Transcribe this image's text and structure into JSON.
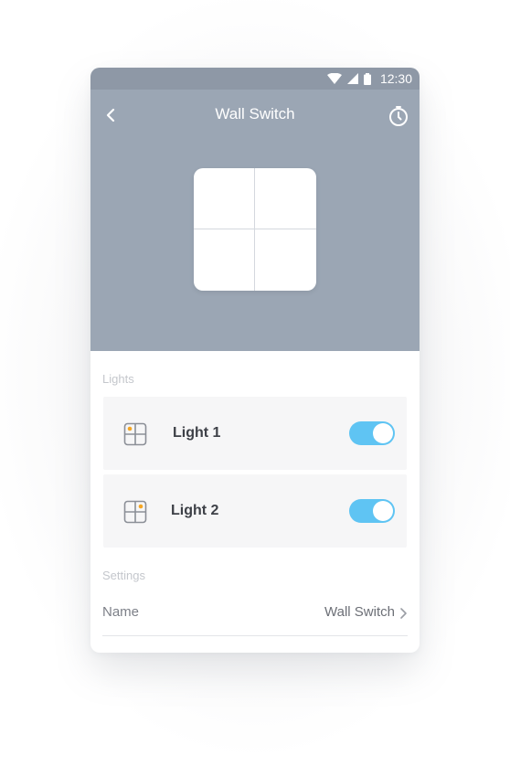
{
  "status_bar": {
    "time": "12:30",
    "icons": [
      "wifi-icon",
      "cellular-signal-icon",
      "battery-icon"
    ],
    "background": "#8e98a6"
  },
  "header": {
    "title": "Wall Switch",
    "back_icon": "back-chevron-icon",
    "timer_icon": "timer-icon",
    "background": "#9ba6b4"
  },
  "lights": {
    "section_label": "Lights",
    "items": [
      {
        "label": "Light 1",
        "on": true,
        "active_quadrant": "top-left",
        "icon": "gang-switch-icon"
      },
      {
        "label": "Light 2",
        "on": true,
        "active_quadrant": "top-right",
        "icon": "gang-switch-icon"
      }
    ]
  },
  "settings": {
    "section_label": "Settings",
    "name_label": "Name",
    "name_value": "Wall Switch",
    "chevron_icon": "chevron-right-icon"
  },
  "colors": {
    "toggle_on": "#5fc4f3",
    "indicator_dot": "#f5a623",
    "card_bg": "#f6f6f7"
  }
}
